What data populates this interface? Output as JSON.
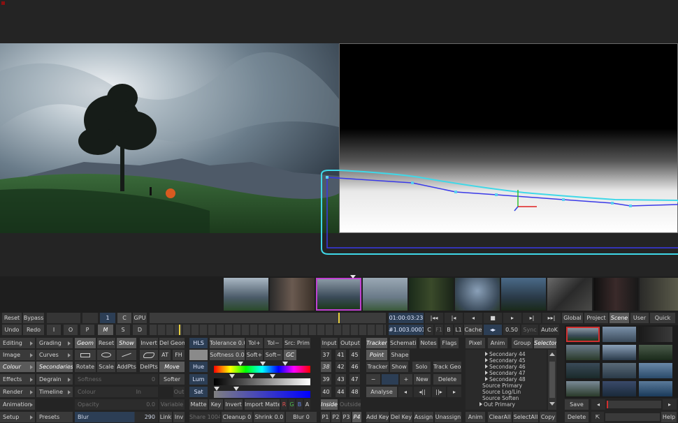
{
  "timecode": "01:00:03:23",
  "frame": "#1.003.00017",
  "clip_flags": [
    "C",
    "F1",
    "B",
    "L1"
  ],
  "cache_label": "Cache",
  "speed": "0.50",
  "sync_label": "Sync",
  "autok_label": "AutoK",
  "scope_tabs": [
    "Global",
    "Project",
    "Scene",
    "User",
    "Quick"
  ],
  "row1": {
    "reset": "Reset",
    "bypass": "Bypass",
    "layer": "1",
    "c": "C",
    "gpu": "GPU"
  },
  "row2": {
    "undo": "Undo",
    "redo": "Redo",
    "i": "I",
    "o": "O",
    "p": "P",
    "m": "M",
    "s": "S",
    "d": "D"
  },
  "menu_col1": [
    "Editing",
    "Image",
    "Colour",
    "Effects",
    "Render",
    "Animation",
    "Setup"
  ],
  "menu_col2": [
    "Grading",
    "Curves",
    "Secondaries",
    "Degrain",
    "Timeline",
    "",
    "Presets"
  ],
  "geom": {
    "geom": "Geom",
    "reset": "Reset",
    "show": "Show",
    "invert": "Invert",
    "del_geom": "Del Geom"
  },
  "shapes": {
    "at": "AT",
    "fh": "FH"
  },
  "transform": {
    "rotate": "Rotate",
    "scale": "Scale",
    "add_pts": "AddPts",
    "del_pts": "DelPts",
    "move": "Move"
  },
  "fields": {
    "softness": {
      "label": "Softness",
      "value": "0"
    },
    "colour": {
      "label": "Colour",
      "in": "In",
      "out": "Out"
    },
    "opacity": {
      "label": "Opacity",
      "value": "0.0",
      "variable": "Variable"
    },
    "blur": {
      "label": "Blur",
      "value": "290"
    },
    "softer": "Softer",
    "link": "Link",
    "inv": "Inv"
  },
  "hls": {
    "hls": "HLS",
    "tolerance_label": "Tolerance",
    "tolerance_value": "0.0",
    "tol_plus": "Tol+",
    "tol_minus": "Tol−",
    "src_prim": "Src: Prim",
    "softness_label": "Softness",
    "softness_value": "0.0",
    "soft_plus": "Soft+",
    "soft_minus": "Soft−",
    "gc": "GC",
    "hue": "Hue",
    "lum": "Lum",
    "sat": "Sat"
  },
  "matte": {
    "matte": "Matte",
    "key": "Key",
    "invert": "Invert",
    "import_matte": "Import Matte",
    "channels": [
      "R",
      "G",
      "B",
      "A"
    ],
    "share_label": "Share",
    "share_value": "1004",
    "cleanup_label": "Cleanup",
    "cleanup_value": "0",
    "shrink_label": "Shrink",
    "shrink_value": "0.0",
    "blur_label": "Blur",
    "blur_value": "0"
  },
  "io": {
    "input": "Input",
    "output": "Output",
    "inside": "Inside",
    "outside": "Outside"
  },
  "numpad": [
    "37",
    "41",
    "45",
    "38",
    "42",
    "46",
    "39",
    "43",
    "47",
    "40",
    "44",
    "48"
  ],
  "pages": [
    "P1",
    "P2",
    "P3",
    "P4"
  ],
  "tracker": {
    "tracker": "Tracker",
    "schematic": "Schematic",
    "notes": "Notes",
    "flags": "Flags",
    "point": "Point",
    "shape": "Shape",
    "tracker2": "Tracker",
    "show": "Show",
    "solo": "Solo",
    "track_geom": "Track Geom",
    "minus": "−",
    "plus": "+",
    "new": "New",
    "delete": "Delete",
    "analyse": "Analyse"
  },
  "keys": {
    "add_key": "Add Key",
    "del_key": "Del Key",
    "assign": "Assign",
    "unassign": "Unassign"
  },
  "list_tabs": [
    "Pixel",
    "Anim",
    "Group",
    "Selector"
  ],
  "layer_list": [
    "Secondary 44",
    "Secondary 45",
    "Secondary 46",
    "Secondary 47",
    "Secondary 48",
    "Source Primary",
    "Source Log/Lin",
    "Source Soften",
    "Out Primary"
  ],
  "list_buttons": {
    "anim": "Anim",
    "clear_all": "ClearAll",
    "select_all": "SelectAll",
    "copy": "Copy"
  },
  "gallery": {
    "save": "Save",
    "delete": "Delete",
    "help": "Help"
  },
  "colors": {
    "accent_cyan": "#3fd8e8",
    "spline_blue": "#3a3ae8",
    "selected_thumb": "#c040d0"
  },
  "icons": [
    "play-backward-icon",
    "step-back-icon",
    "rewind-icon",
    "stop-icon",
    "play-icon",
    "step-forward-icon",
    "fast-forward-icon",
    "close-icon"
  ]
}
